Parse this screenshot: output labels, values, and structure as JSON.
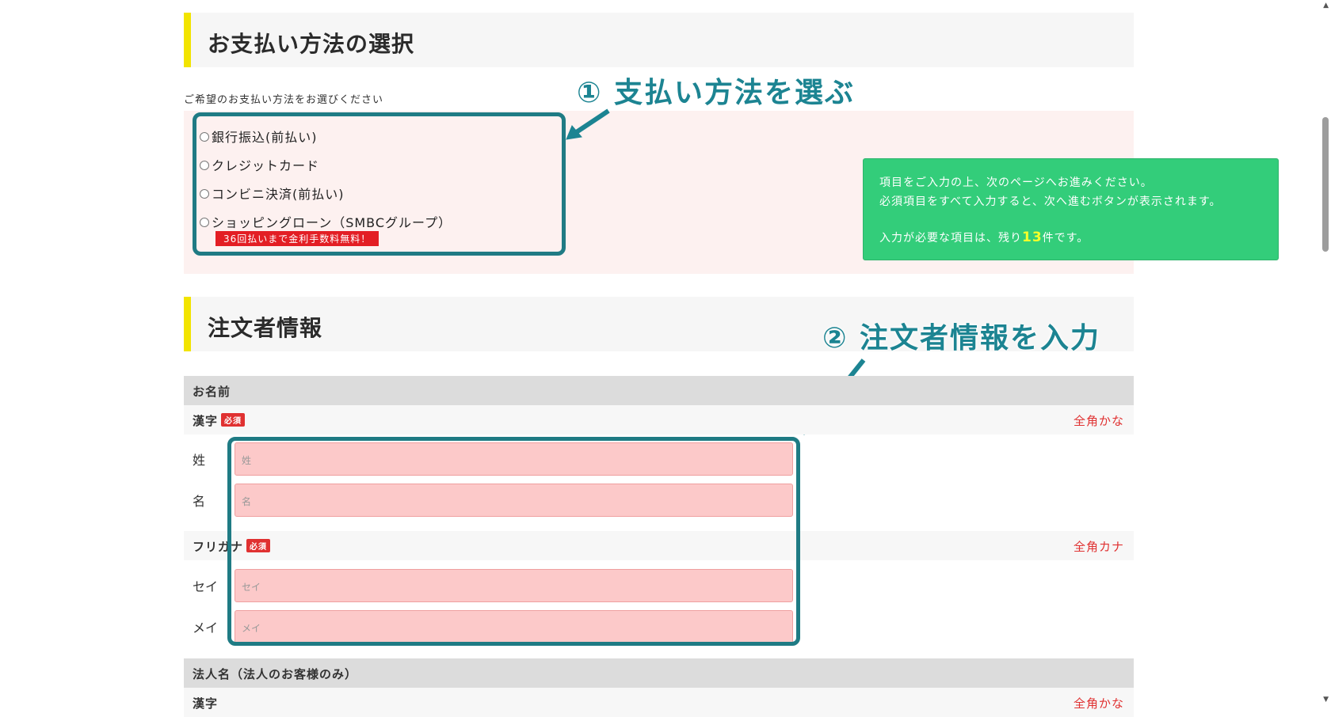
{
  "payment_section": {
    "title": "お支払い方法の選択",
    "note": "ご希望のお支払い方法をお選びください",
    "options": [
      {
        "label": "銀行振込(前払い)"
      },
      {
        "label": "クレジットカード"
      },
      {
        "label": "コンビニ決済(前払い)"
      },
      {
        "label": "ショッピングローン（SMBCグループ）"
      }
    ],
    "promo": "36回払いまで金利手数料無料！"
  },
  "callouts": {
    "step1": "① 支払い方法を選ぶ",
    "step2": "② 注文者情報を入力"
  },
  "info_box": {
    "line1": "項目をご入力の上、次のページへお進みください。",
    "line2": "必須項目をすべて入力すると、次へ進むボタンが表示されます。",
    "line3_prefix": "入力が必要な項目は、残り",
    "remaining_count": "13",
    "line3_suffix": "件です。"
  },
  "orderer_section": {
    "title": "注文者情報",
    "name_group": "お名前",
    "kanji_label": "漢字",
    "required_badge": "必須",
    "kanji_hint": "全角かな",
    "sei_label": "姓",
    "sei_placeholder": "姓",
    "mei_label": "名",
    "mei_placeholder": "名",
    "kana_label": "フリガナ",
    "kana_hint": "全角カナ",
    "sei_kana_label": "セイ",
    "sei_kana_placeholder": "セイ",
    "mei_kana_label": "メイ",
    "mei_kana_placeholder": "メイ",
    "corp_group": "法人名（法人のお客様のみ）",
    "corp_kanji_label": "漢字",
    "corp_kanji_hint": "全角かな"
  },
  "colors": {
    "accent_yellow": "#f2e400",
    "callout_teal": "#1c8492",
    "info_green": "#33cd7a",
    "required_red": "#e03131",
    "input_pink": "#fcc9c9"
  }
}
